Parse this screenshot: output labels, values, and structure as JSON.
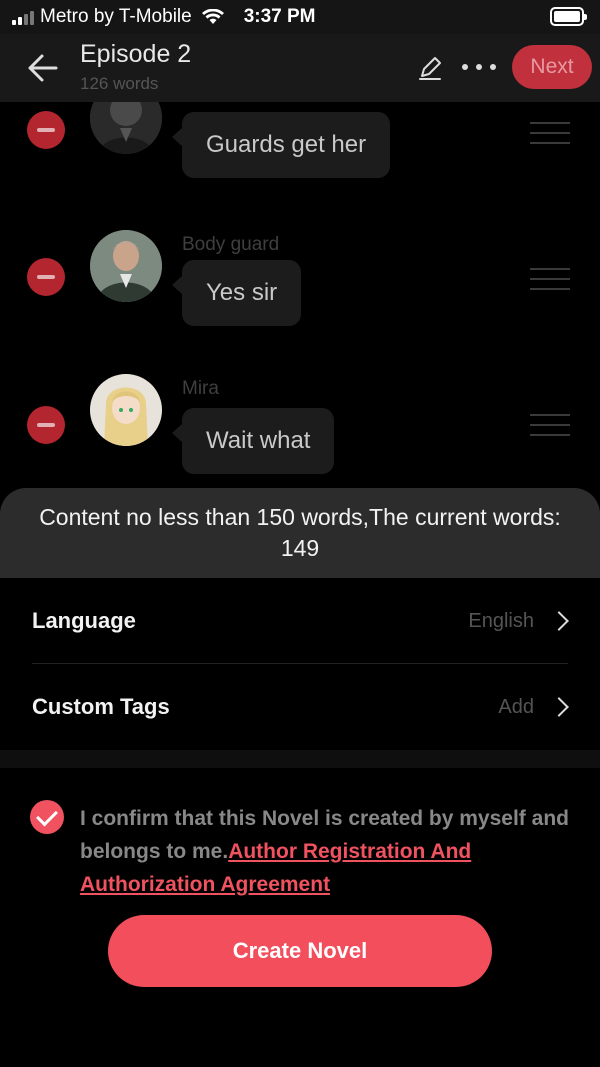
{
  "status_bar": {
    "carrier": "Metro by T-Mobile",
    "time": "3:37 PM"
  },
  "header": {
    "title": "Episode 2",
    "subtitle": "126 words",
    "next_label": "Next"
  },
  "chat": [
    {
      "speaker": "",
      "message": "Guards get her"
    },
    {
      "speaker": "Body guard",
      "message": "Yes sir"
    },
    {
      "speaker": "Mira",
      "message": "Wait what"
    }
  ],
  "toast": {
    "message": "Content no less than 150 words,The current words: 149"
  },
  "settings": {
    "language": {
      "label": "Language",
      "value": "English"
    },
    "tags": {
      "label": "Custom Tags",
      "value": "Add"
    }
  },
  "confirm": {
    "text": "I confirm that this Novel is created by myself and belongs to me.",
    "link": "Author Registration And Authorization Agreement",
    "checked": true
  },
  "create_button": "Create Novel",
  "colors": {
    "accent": "#f24e5c",
    "remove": "#b3262f"
  }
}
